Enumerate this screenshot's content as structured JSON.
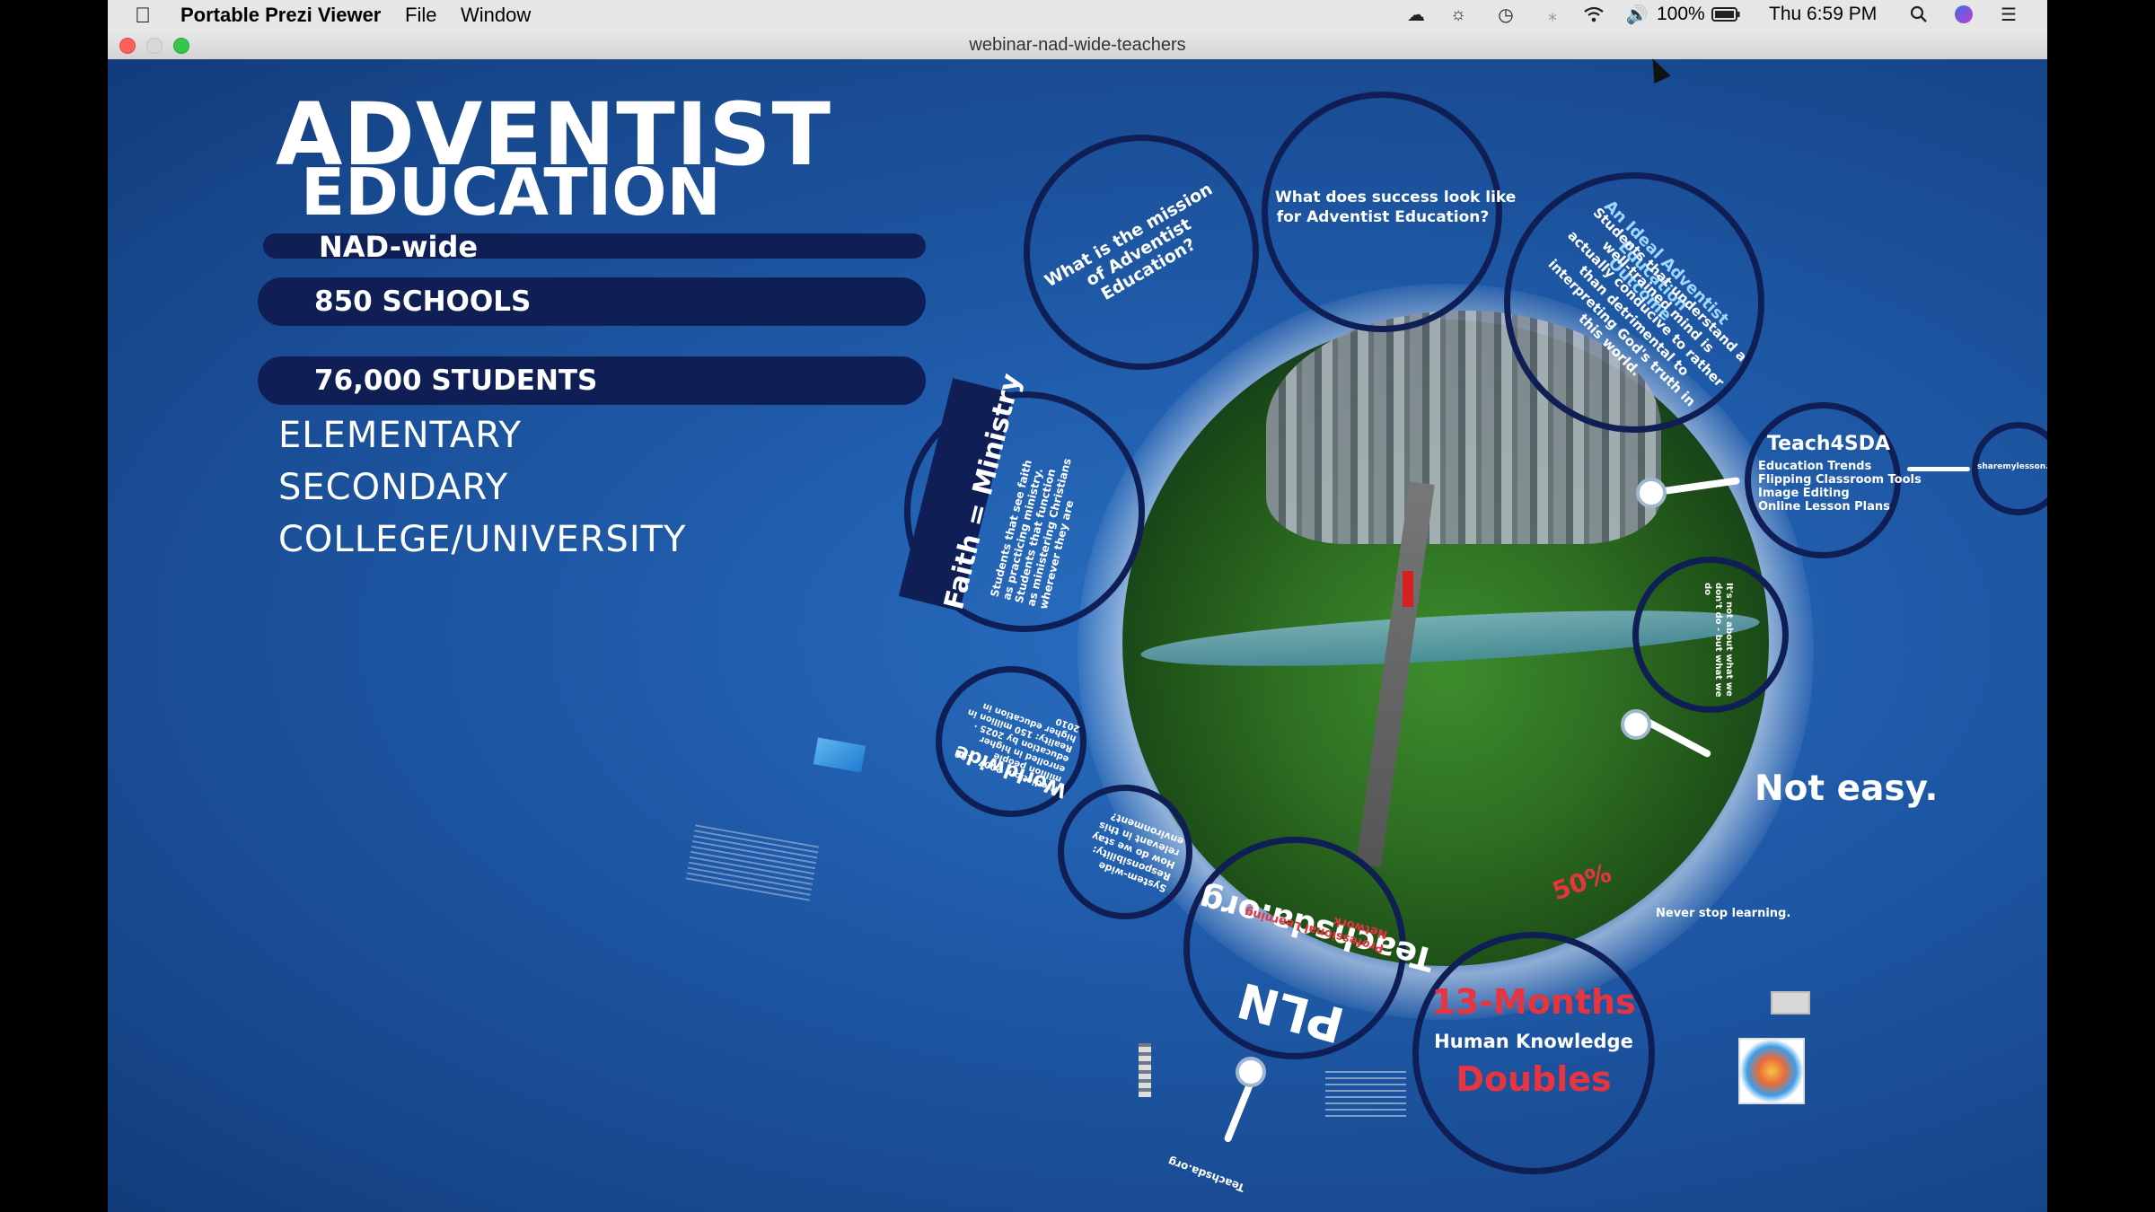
{
  "menubar": {
    "apple_icon": "apple-icon",
    "app_name": "Portable Prezi Viewer",
    "menus": [
      "File",
      "Window"
    ],
    "status": {
      "battery": "100%",
      "clock": "Thu 6:59 PM"
    },
    "icons": [
      "creative-cloud-icon",
      "cloud-icon",
      "time-machine-icon",
      "bluetooth-icon",
      "wifi-icon",
      "volume-icon",
      "battery-icon",
      "spotlight-icon",
      "siri-icon",
      "notification-center-icon"
    ]
  },
  "window": {
    "title": "webinar-nad-wide-teachers"
  },
  "slide": {
    "title_line1": "ADVENTIST",
    "title_line2": "EDUCATION",
    "bar1": "NAD-wide",
    "bar2": "850 SCHOOLS",
    "bar3": "76,000 STUDENTS",
    "levels": [
      "ELEMENTARY",
      "SECONDARY",
      "COLLEGE/UNIVERSITY"
    ]
  },
  "circles": {
    "mission": "What is the mission of Adventist Education?",
    "success_l1": "What does success look like",
    "success_l2": "for Adventist Education?",
    "outcome_title": "An Ideal Adventist Education Outcome",
    "outcome_body": "Students that understand a well-trained mind is actually conducive to rather than detrimental to interpreting God's truth in this world.",
    "faith_label": "Faith = Ministry",
    "faith_body": "Students that see faith as practicing ministry. Students that function as ministering Christians wherever they are",
    "teach4sda_title": "Teach4SDA",
    "teach4sda_items": [
      "Education Trends",
      "Flipping Classroom Tools",
      "Image Editing",
      "Online Lesson Plans"
    ],
    "sharemylesson": "sharemylesson.com",
    "worldwide_label": "Worldwide",
    "worldwide_body": "Prediction: 2007, 100 million people enrolled in higher education by 2025 · Reality: 150 million in higher education in 2010",
    "systemwide_body": "System-wide Responsibility: How do we stay relevant in this environment?",
    "teachsda": "Teachsda.org",
    "pln": "PLN",
    "pln_sub": "Professional Learning Network",
    "months": "13-Months",
    "human_knowledge": "Human Knowledge",
    "doubles": "Doubles",
    "not_easy": "Not easy.",
    "never_stop": "Never stop learning.",
    "its_not_about": "It's not about what we don't do - but what we do",
    "percent": "50%",
    "teachsda_bottom": "Teachsda.org"
  },
  "colors": {
    "canvas_blue": "#1f5aa8",
    "navy": "#0f1e55",
    "accent_red": "#e8343f",
    "white": "#ffffff"
  }
}
